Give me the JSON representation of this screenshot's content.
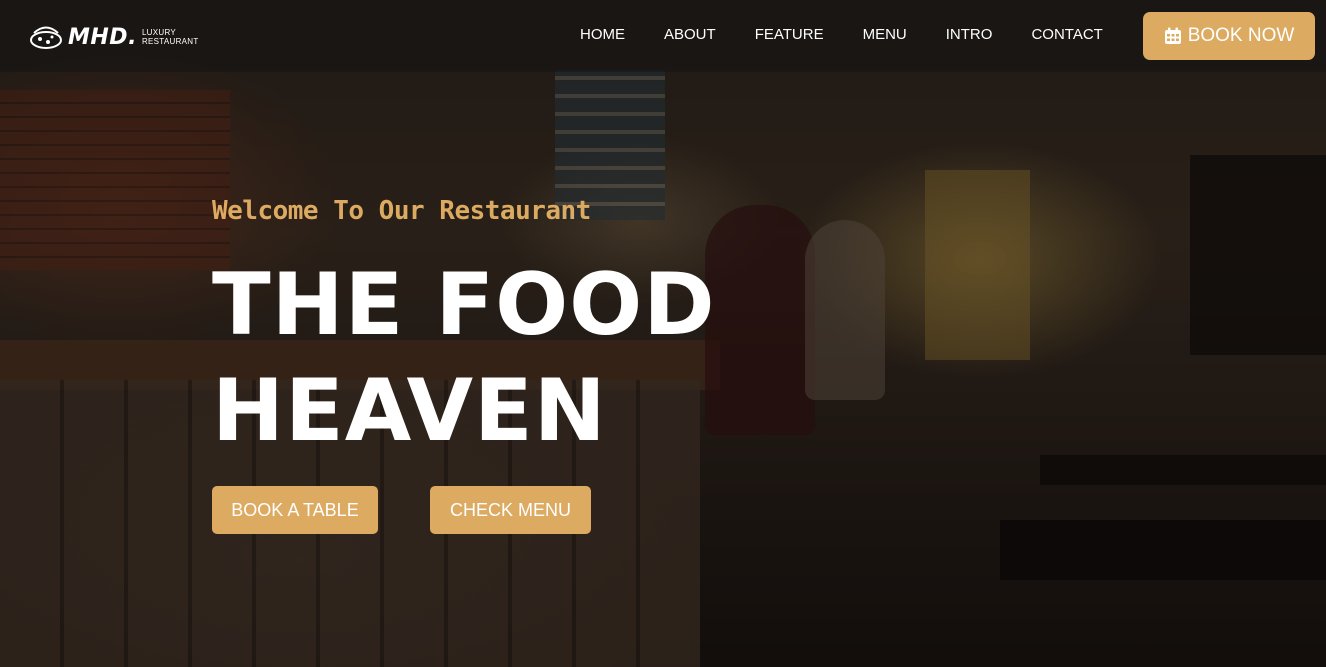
{
  "brand": {
    "name": "MHD.",
    "tagline_line1": "LUXURY",
    "tagline_line2": "RESTAURANT"
  },
  "nav": {
    "items": [
      {
        "label": "HOME"
      },
      {
        "label": "ABOUT"
      },
      {
        "label": "FEATURE"
      },
      {
        "label": "MENU"
      },
      {
        "label": "INTRO"
      },
      {
        "label": "CONTACT"
      }
    ],
    "cta_label": "BOOK NOW",
    "cta_icon": "calendar-icon"
  },
  "hero": {
    "subtitle": "Welcome To Our Restaurant",
    "title_line1": "THE FOOD",
    "title_line2": "HEAVEN",
    "primary_button": "BOOK A TABLE",
    "secondary_button": "CHECK MENU"
  },
  "colors": {
    "accent": "#dcaa61",
    "text": "#ffffff",
    "nav_bg": "rgba(20,20,20,0.55)"
  }
}
